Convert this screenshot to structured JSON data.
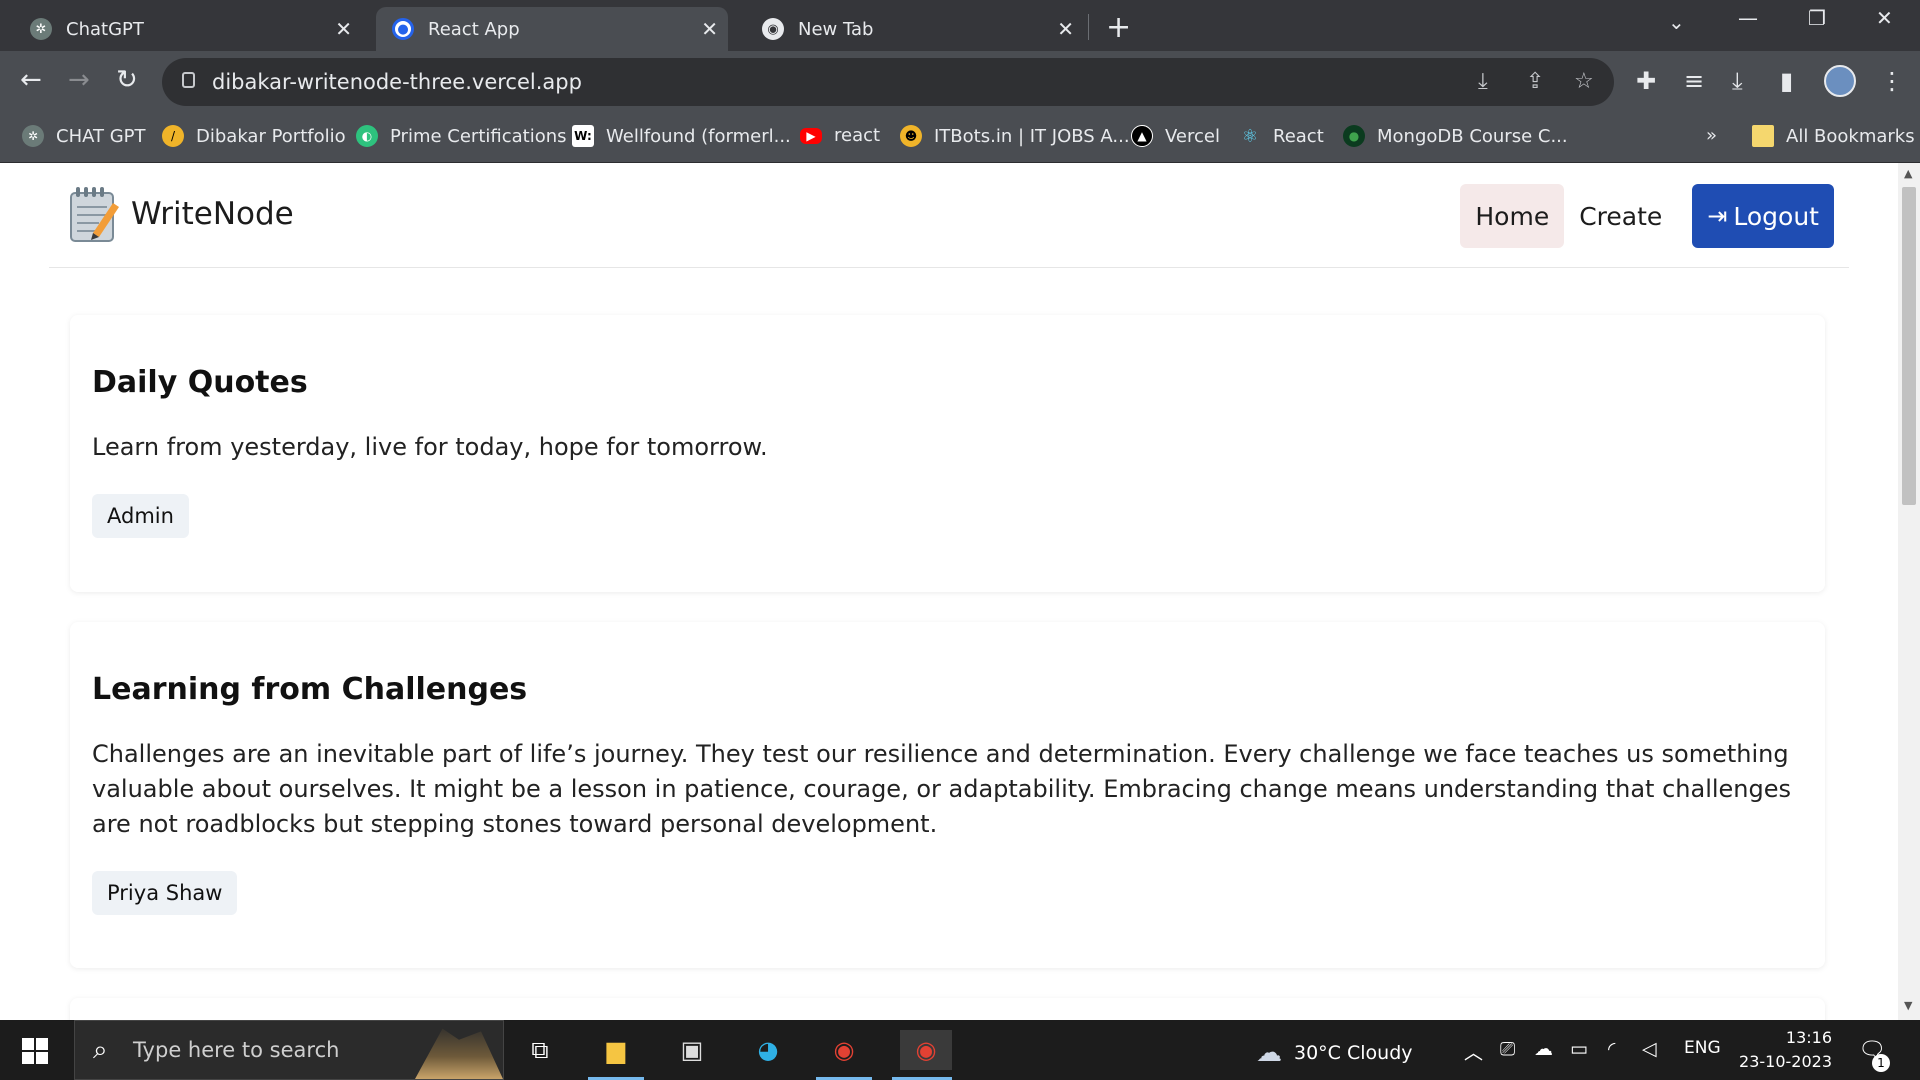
{
  "tabs": [
    {
      "title": "ChatGPT",
      "icon": "chatgpt-icon"
    },
    {
      "title": "React App",
      "icon": "react-app-icon"
    },
    {
      "title": "New Tab",
      "icon": "chrome-icon"
    }
  ],
  "address_bar": {
    "url": "dibakar-writenode-three.vercel.app"
  },
  "bookmarks": [
    {
      "label": "CHAT GPT"
    },
    {
      "label": "Dibakar Portfolio"
    },
    {
      "label": "Prime Certifications"
    },
    {
      "label": "Wellfound (formerl..."
    },
    {
      "label": "react"
    },
    {
      "label": "ITBots.in | IT JOBS A..."
    },
    {
      "label": "Vercel"
    },
    {
      "label": "React"
    },
    {
      "label": "MongoDB Course C..."
    }
  ],
  "bookmarks_overflow": "»",
  "all_bookmarks": "All Bookmarks",
  "site": {
    "brand": "WriteNode",
    "nav": {
      "home": "Home",
      "create": "Create",
      "logout": "Logout"
    }
  },
  "posts": [
    {
      "title": "Daily Quotes",
      "body": "Learn from yesterday, live for today, hope for tomorrow.",
      "author": "Admin"
    },
    {
      "title": "Learning from Challenges",
      "body": "Challenges are an inevitable part of life’s journey. They test our resilience and determination. Every challenge we face teaches us something valuable about ourselves. It might be a lesson in patience, courage, or adaptability. Embracing change means understanding that challenges are not roadblocks but stepping stones toward personal development.",
      "author": "Priya Shaw"
    }
  ],
  "taskbar": {
    "search_placeholder": "Type here to search",
    "weather": "30°C  Cloudy",
    "language": "ENG",
    "time": "13:16",
    "date": "23-10-2023",
    "notifications": "1"
  }
}
